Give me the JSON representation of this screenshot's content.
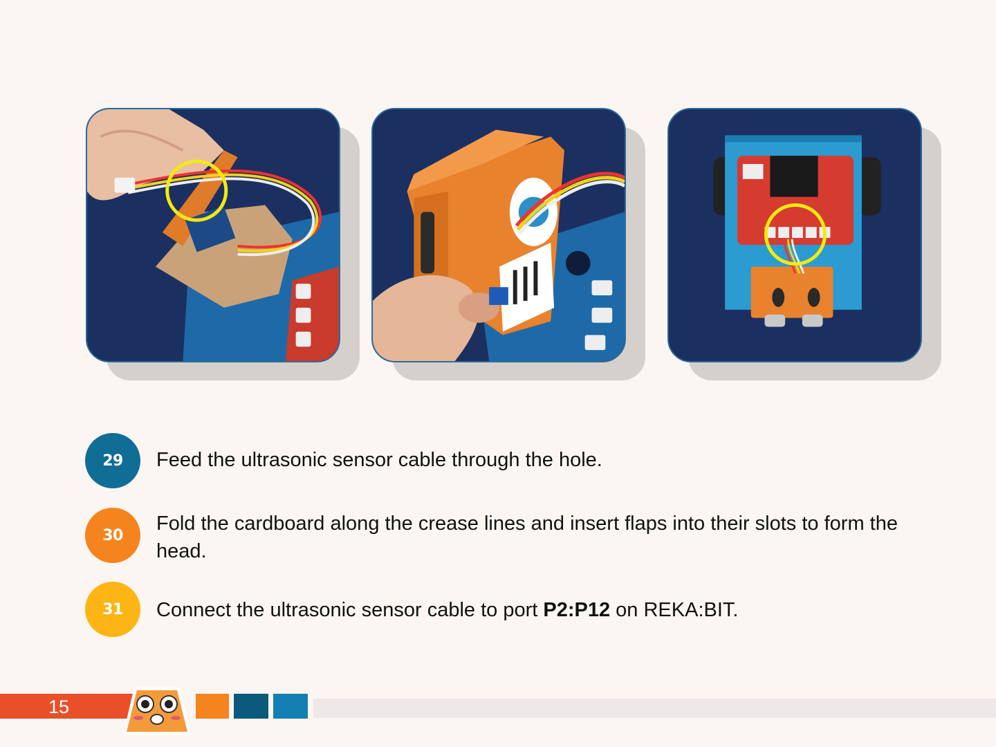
{
  "steps": [
    {
      "number": "29",
      "color": "#0f6d96",
      "text": "Feed the ultrasonic sensor cable through the hole."
    },
    {
      "number": "30",
      "color": "#f5841f",
      "text": "Fold the cardboard along the crease lines and insert flaps into their slots to form the head."
    },
    {
      "number": "31",
      "color": "#fdb515",
      "text_before": "Connect the ultrasonic sensor cable to port ",
      "text_bold": "P2:P12",
      "text_after": " on REKA:BIT."
    }
  ],
  "page_number": "15",
  "colors": {
    "background": "#fcf6f2",
    "footer_red": "#e9502a",
    "footer_orange": "#f5841f",
    "footer_dark_blue": "#0b5a7e",
    "footer_blue": "#1480b1",
    "footer_gray": "#efe8e9",
    "highlight_circle": "#f3ea12"
  },
  "photos": [
    {
      "name": "step-29-photo"
    },
    {
      "name": "step-30-photo"
    },
    {
      "name": "step-31-photo"
    }
  ]
}
